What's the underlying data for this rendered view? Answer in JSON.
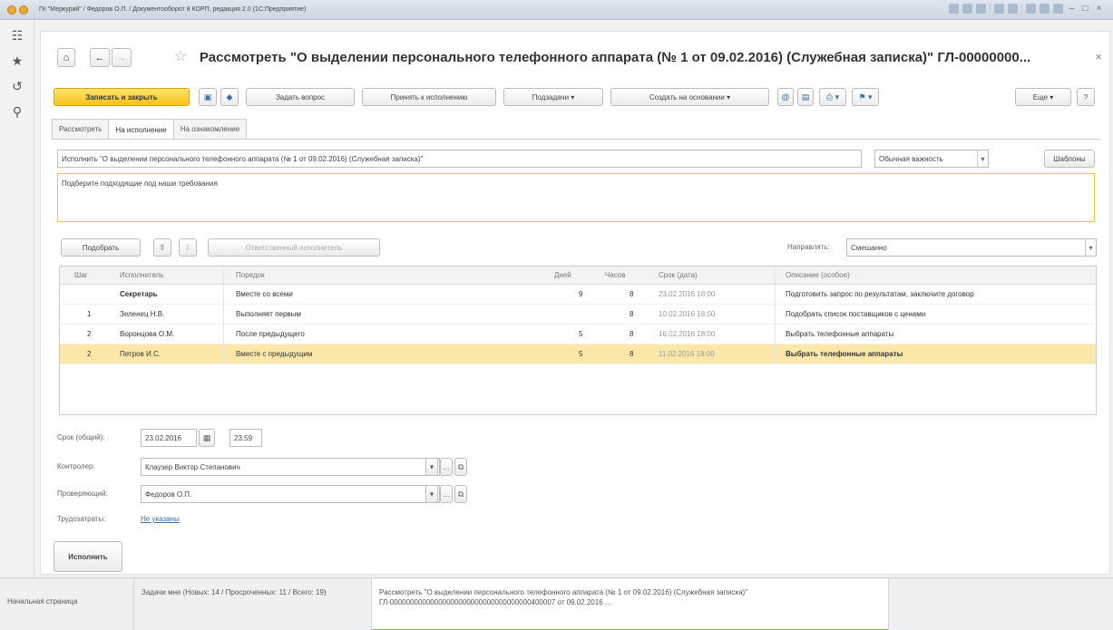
{
  "window": {
    "title": "ГК \"Меркурий\" / Федоров О.П. / Документооборот 8 КОРП, редакция 2.0 (1С:Предприятие)"
  },
  "form": {
    "title": "Рассмотреть \"О выделении персонального телефонного аппарата (№ 1 от 09.02.2016) (Служебная записка)\" ГЛ-00000000...",
    "close": "×",
    "star": "☆",
    "home": "⌂",
    "back": "←",
    "forward": "→"
  },
  "toolbar": {
    "save_close": "Записать и закрыть",
    "ask_question": "Задать вопрос",
    "accept": "Принять к исполнению",
    "subtasks": "Подзадачи",
    "create_based": "Создать на основании",
    "more": "Еще",
    "help": "?"
  },
  "tabs": [
    "Рассмотреть",
    "На исполнение",
    "На ознакомление"
  ],
  "task": {
    "name": "Исполнить \"О выделении персонального телефонного аппарата (№ 1 от 09.02.2016) (Служебная записка)\"",
    "importance": "Обычная важность",
    "templates": "Шаблоны",
    "description": "Подберите подходящие под наши требования"
  },
  "grid_toolbar": {
    "pick": "Подобрать",
    "complex_executor": "Ответственный исполнитель",
    "direct_label": "Направлять:",
    "direct_value": "Смешанно"
  },
  "grid": {
    "headers": [
      "Шаг",
      "Исполнитель",
      "Порядок",
      "Дней",
      "Часов",
      "Срок (дата)",
      "Описание (особое)"
    ],
    "rows": [
      {
        "step": "",
        "executor": "Секретарь",
        "order": "Вместе со всеми",
        "days": "9",
        "hours": "8",
        "due": "23.02.2016 18:00",
        "desc": "Подготовить запрос по результатам, заключите договор"
      },
      {
        "step": "1",
        "executor": "Зеленец Н.В.",
        "order": "Выполняет первым",
        "days": "",
        "hours": "8",
        "due": "10.02.2016 18:00",
        "desc": "Подобрать список поставщиков с ценами"
      },
      {
        "step": "2",
        "executor": "Воронцова О.М.",
        "order": "После предыдущего",
        "days": "5",
        "hours": "8",
        "due": "16.02.2016 18:00",
        "desc": "Выбрать телефонные аппараты"
      },
      {
        "step": "2",
        "executor": "Петров И.С.",
        "order": "Вместе с предыдущим",
        "days": "5",
        "hours": "8",
        "due": "11.02.2016 18:00",
        "desc": "Выбрать телефонные аппараты"
      }
    ]
  },
  "fields": {
    "due_label": "Срок (общий):",
    "due_date": "23.02.2016",
    "due_time": "23:59",
    "controller_label": "Контролер:",
    "controller": "Клаузер Виктор Степанович",
    "checker_label": "Проверяющий:",
    "checker": "Федоров О.П.",
    "labor_label": "Трудозатраты:",
    "labor_value": "Не указаны"
  },
  "execute_button": "Исполнить",
  "taskbar": {
    "home": "Начальная страница",
    "tasks": "Задачи мне (Новых: 14 / Просроченных: 11 / Всего: 19)",
    "current": "Рассмотреть \"О выделении персонального телефонного аппарата (№ 1 от 09.02.2016) (Служебная записка)\" ГЛ-00000000000000000000000000000000000400007 от 09.02.2016 ..."
  }
}
